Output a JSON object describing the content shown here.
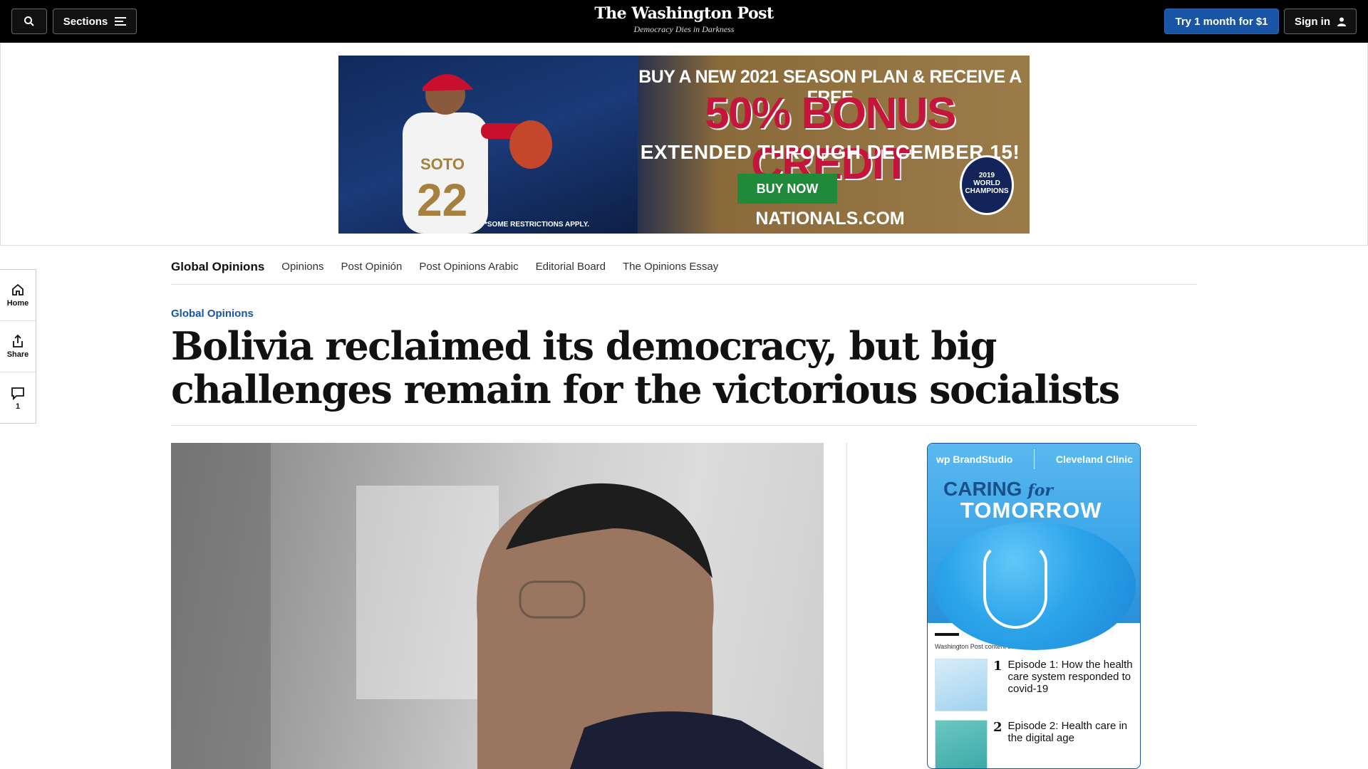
{
  "header": {
    "sections_label": "Sections",
    "logo": "The Washington Post",
    "tagline": "Democracy Dies in Darkness",
    "trial_label": "Try 1 month for $1",
    "signin_label": "Sign in"
  },
  "ad": {
    "line1": "BUY A NEW 2021 SEASON PLAN & RECEIVE A FREE",
    "line2": "50% BONUS CREDIT",
    "line3": "EXTENDED THROUGH DECEMBER 15!",
    "cta": "BUY NOW",
    "site": "NATIONALS.COM",
    "restrictions": "*SOME RESTRICTIONS APPLY.",
    "jersey_name": "SOTO",
    "jersey_number": "22",
    "badge_year": "2019",
    "badge_line1": "WORLD",
    "badge_line2": "CHAMPIONS"
  },
  "subnav": {
    "brand": "Global Opinions",
    "links": [
      "Opinions",
      "Post Opinión",
      "Post Opinions Arabic",
      "Editorial Board",
      "The Opinions Essay"
    ]
  },
  "rail": {
    "home": "Home",
    "share": "Share",
    "comments_count": "1"
  },
  "article": {
    "kicker": "Global Opinions",
    "headline": "Bolivia reclaimed its democracy, but big challenges remain for the victorious socialists"
  },
  "sponsor": {
    "brand_left": "wp BrandStudio",
    "brand_right": "Cleveland Clinic",
    "title_a": "CARING",
    "title_for": "for",
    "title_b": "TOMORROW",
    "selected_by": "Washington Post content selected by",
    "items": [
      {
        "num": "1",
        "title": "Episode 1: How the health care system responded to covid-19"
      },
      {
        "num": "2",
        "title": "Episode 2: Health care in the digital age"
      }
    ]
  }
}
